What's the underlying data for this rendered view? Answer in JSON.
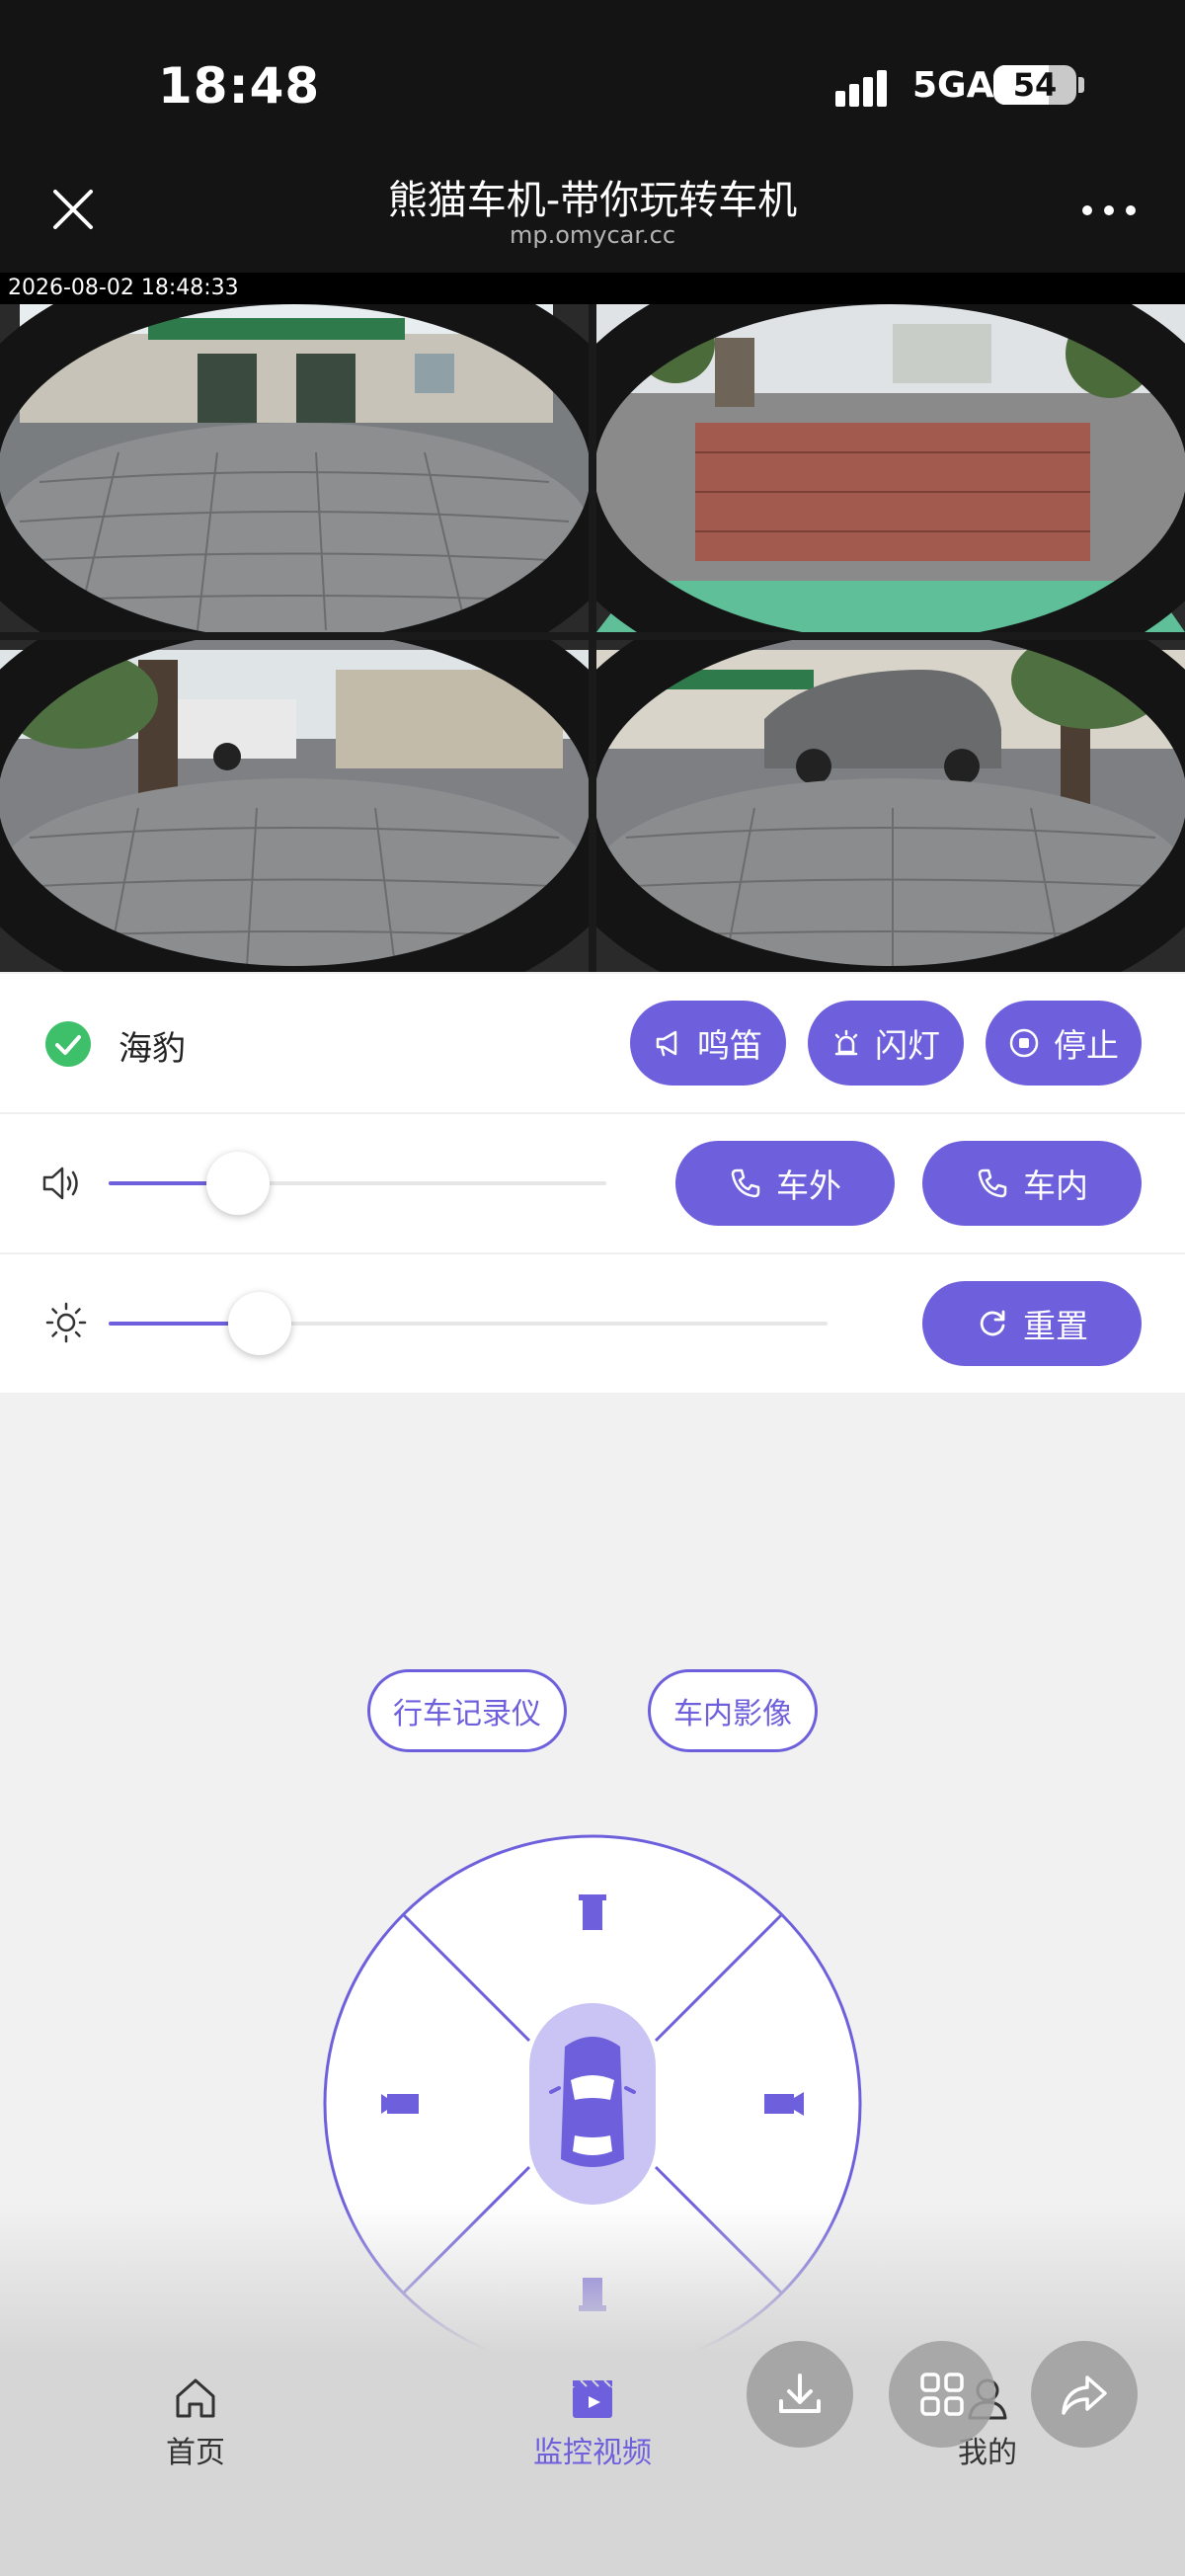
{
  "status_bar": {
    "time": "18:48",
    "network": "5GA",
    "battery": "54"
  },
  "header": {
    "title": "熊猫车机-带你玩转车机",
    "subtitle": "mp.omycar.cc"
  },
  "video": {
    "timestamp": "2026-08-02 18:48:33"
  },
  "vehicle": {
    "name": "海豹",
    "status": "online"
  },
  "actions": {
    "honk": "鸣笛",
    "flash": "闪灯",
    "stop": "停止"
  },
  "volume": {
    "level": 0.26,
    "call_outside": "车外",
    "call_inside": "车内"
  },
  "brightness": {
    "level": 0.21,
    "reset": "重置"
  },
  "modes": {
    "dashcam": "行车记录仪",
    "cabin": "车内影像"
  },
  "nav": {
    "home": "首页",
    "monitor": "监控视频",
    "mine": "我的"
  },
  "colors": {
    "accent": "#6e60dd",
    "accent_light": "#c9c4f3",
    "success": "#3ec06b"
  }
}
